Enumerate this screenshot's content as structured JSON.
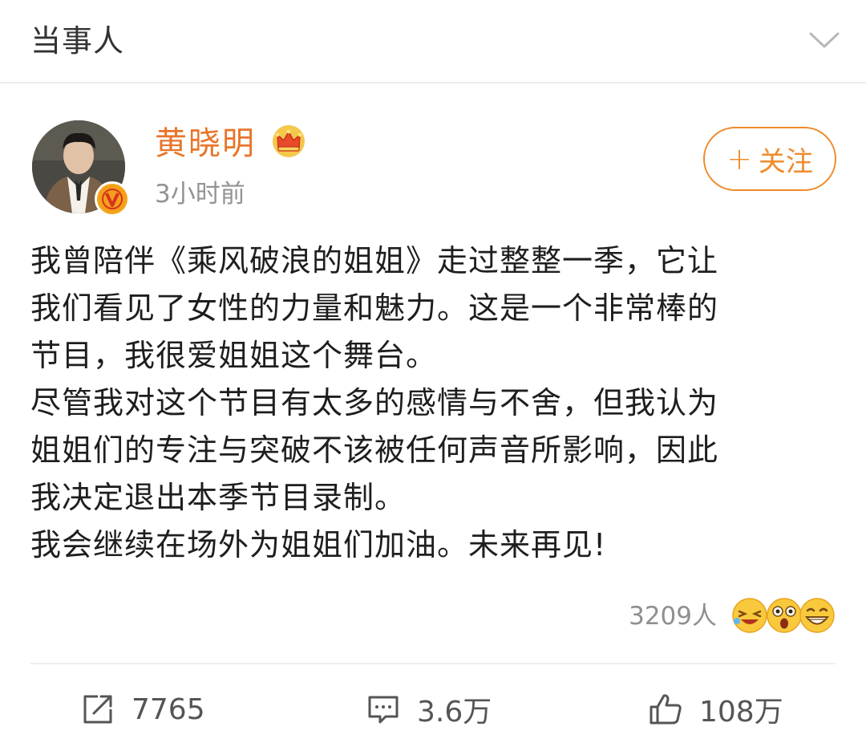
{
  "section": {
    "title": "当事人",
    "collapse_icon": "chevron-down-icon"
  },
  "author": {
    "name": "黄晓明",
    "badge_icon": "crown-icon",
    "verified_icon": "verified-v-icon",
    "time": "3小时前"
  },
  "follow": {
    "plus": "+",
    "label": "关注"
  },
  "post": {
    "lines": [
      "我曾陪伴《乘风破浪的姐姐》走过整整一季，它让",
      "我们看见了女性的力量和魅力。这是一个非常棒的",
      "节目，我很爱姐姐这个舞台。",
      "尽管我对这个节目有太多的感情与不舍，但我认为",
      "姐姐们的专注与突破不该被任何声音所影响，因此",
      "我决定退出本季节目录制。",
      "我会继续在场外为姐姐们加油。未来再见!"
    ]
  },
  "reactions": {
    "count": "3209人",
    "emojis": [
      "laughing-emoji",
      "shocked-emoji",
      "grinning-emoji"
    ]
  },
  "actions": {
    "repost": {
      "icon": "share-icon",
      "count": "7765"
    },
    "comment": {
      "icon": "comment-icon",
      "count": "3.6万"
    },
    "like": {
      "icon": "thumbs-up-icon",
      "count": "108万"
    }
  },
  "colors": {
    "accent": "#f08b2c",
    "name": "#e7762b",
    "muted": "#939393",
    "text": "#1e1e1e"
  }
}
